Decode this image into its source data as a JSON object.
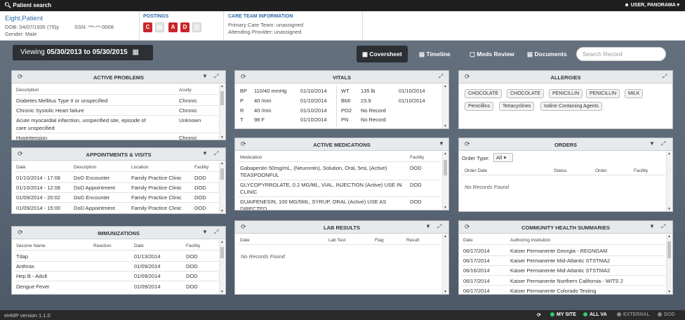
{
  "topbar": {
    "search_label": "Patient search",
    "user_label": "USER, PANORAMA"
  },
  "patient": {
    "name": "Eight,Patient",
    "dob": "DOB: 04/07/1935 (79)y",
    "ssn": "SSN: ***-**-0008",
    "gender": "Gender: Male"
  },
  "postings": {
    "title": "POSTINGS",
    "items": [
      "C",
      "W",
      "A",
      "D",
      "F"
    ]
  },
  "care_team": {
    "title": "CARE TEAM INFORMATION",
    "primary": "Primary Care Team: unassigned",
    "attending": "Attending Provider: unassigned"
  },
  "viewing": {
    "prefix": "Viewing",
    "range": "05/30/2013 to 05/30/2015"
  },
  "tabs": [
    "Coversheet",
    "Timeline",
    "Meds Review",
    "Documents"
  ],
  "search": {
    "placeholder": "Search Record"
  },
  "active_problems": {
    "title": "ACTIVE PROBLEMS",
    "headers": [
      "Description",
      "Acuity"
    ],
    "rows": [
      [
        "Diabetes Mellitus Type II or unspecified",
        "Chronic"
      ],
      [
        "Chronic Systolic Heart failure",
        "Chronic"
      ],
      [
        "Acute myocardial infarction, unspecified site, episode of",
        "Unknown"
      ],
      [
        "care unspecified",
        ""
      ],
      [
        "Hypertension",
        "Chronic"
      ]
    ]
  },
  "vitals": {
    "title": "VITALS",
    "left": [
      [
        "BP",
        "110/40 mmHg",
        "01/10/2014"
      ],
      [
        "P",
        "40 /min",
        "01/10/2014"
      ],
      [
        "R",
        "40 /min",
        "01/10/2014"
      ],
      [
        "T",
        "98 F",
        "01/10/2014"
      ]
    ],
    "right": [
      [
        "WT",
        "135 lb",
        "01/10/2014"
      ],
      [
        "BMI",
        "23.9",
        "01/10/2014"
      ],
      [
        "PO2",
        "No Record",
        ""
      ],
      [
        "PN",
        "No Record",
        ""
      ]
    ]
  },
  "allergies": {
    "title": "ALLERGIES",
    "row1": [
      "CHOCOLATE",
      "CHOCOLATE",
      "PENICILLIN",
      "PENICILLIN",
      "MILK"
    ],
    "row2": [
      "Penicillins",
      "Tetracyclines",
      "Iodine Containing Agents"
    ]
  },
  "appointments": {
    "title": "APPOINTMENTS & VISITS",
    "headers": [
      "Date",
      "Description",
      "Location",
      "Facility"
    ],
    "rows": [
      [
        "01/10/2014 - 17:08",
        "DoD Encounter",
        "Family Practice Clinic",
        "DOD"
      ],
      [
        "01/10/2014 - 12:08",
        "DoD Appointment",
        "Family Practice Clinic",
        "DOD"
      ],
      [
        "01/09/2014 - 20:02",
        "DoD Encounter",
        "Family Practice Clinic",
        "DOD"
      ],
      [
        "01/09/2014 - 15:00",
        "DoD Appointment",
        "Family Practice Clinic",
        "DOD"
      ]
    ]
  },
  "medications": {
    "title": "ACTIVE MEDICATIONS",
    "headers": [
      "Medication",
      "Facility"
    ],
    "rows": [
      [
        "Gabapentin 50mg/mL, (Neurontin), Solution, Oral, 5mL (Active)",
        "TEASPOONFUL",
        "DOD"
      ],
      [
        "GLYCOPYRROLATE, 0.2 MG/ML, VIAL, INJECTION (Active) USE IN",
        "CLINIC",
        "DOD"
      ],
      [
        "GUAIFENESIN, 100 MG/5ML, SYRUP, ORAL (Active) USE AS",
        "DIRECTED",
        "DOD"
      ]
    ]
  },
  "orders": {
    "title": "ORDERS",
    "type_label": "Order Type:",
    "type_value": "All",
    "headers": [
      "Order Date",
      "Status",
      "Order",
      "Facility"
    ],
    "empty": "No Records Found"
  },
  "immunizations": {
    "title": "IMMUNIZATIONS",
    "headers": [
      "Vaccine Name",
      "Reaction",
      "Date",
      "Facility"
    ],
    "rows": [
      [
        "Tdap",
        "",
        "01/13/2014",
        "DOD"
      ],
      [
        "Anthrax",
        "",
        "01/09/2014",
        "DOD"
      ],
      [
        "Hep B - Adult",
        "",
        "01/09/2014",
        "DOD"
      ],
      [
        "Dengue Fever",
        "",
        "01/09/2014",
        "DOD"
      ]
    ]
  },
  "lab_results": {
    "title": "LAB RESULTS",
    "headers": [
      "Date",
      "Lab Test",
      "Flag",
      "Result"
    ],
    "empty": "No Records Found"
  },
  "community": {
    "title": "COMMUNITY HEALTH SUMMARIES",
    "headers": [
      "Date",
      "Authoring Institution"
    ],
    "rows": [
      [
        "06/17/2014",
        "Kaiser Permanente Georgia - REGNGAM"
      ],
      [
        "06/17/2014",
        "Kaiser Permanente Mid-Atlantic STSTMA2"
      ],
      [
        "06/16/2014",
        "Kaiser Permanente Mid-Atlantic STSTMA2"
      ],
      [
        "06/17/2014",
        "Kaiser Permanente Northern California - WITS 2"
      ],
      [
        "06/17/2014",
        "Kaiser Permanente Colorado Testing"
      ]
    ]
  },
  "footer": {
    "version": "eHMP version 1.1.0",
    "sites": [
      "MY SITE",
      "ALL VA",
      "EXTERNAL",
      "DOD"
    ],
    "colors": {
      "my_site": "#2ecc71",
      "all_va": "#2ecc71",
      "external": "#888888",
      "dod": "#888888"
    }
  },
  "colors": {
    "posting_active": "#c9252b",
    "link": "#2d6ca8"
  }
}
